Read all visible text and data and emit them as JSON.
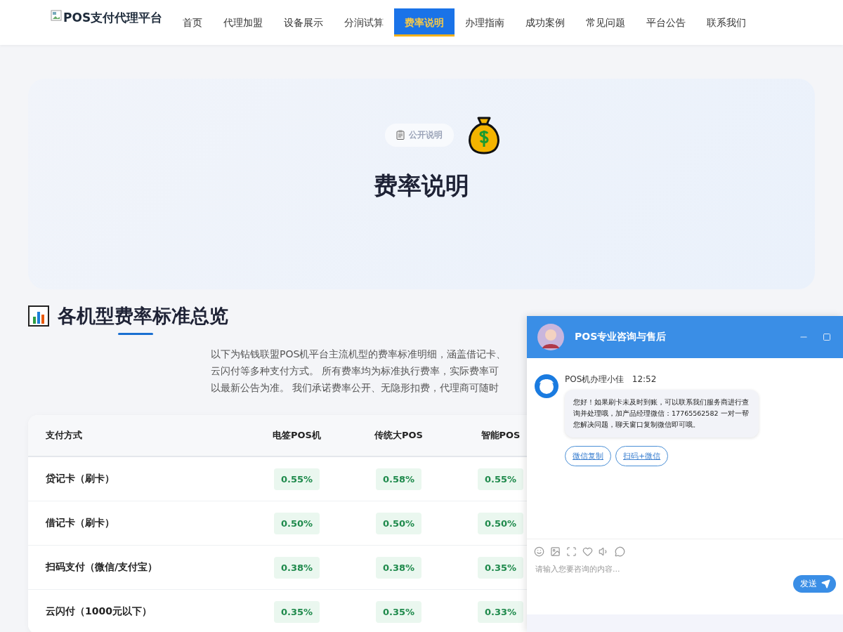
{
  "logo": {
    "alt_text": "POS支付代理平台"
  },
  "nav": [
    {
      "label": "首页",
      "selected": false
    },
    {
      "label": "代理加盟",
      "selected": false
    },
    {
      "label": "设备展示",
      "selected": false
    },
    {
      "label": "分润试算",
      "selected": false
    },
    {
      "label": "费率说明",
      "selected": true
    },
    {
      "label": "办理指南",
      "selected": false
    },
    {
      "label": "成功案例",
      "selected": false
    },
    {
      "label": "常见问题",
      "selected": false
    },
    {
      "label": "平台公告",
      "selected": false
    },
    {
      "label": "联系我们",
      "selected": false
    }
  ],
  "hero": {
    "badge": "公开说明",
    "title": "费率说明"
  },
  "section": {
    "title": "各机型费率标准总览",
    "intro_lines": [
      "以下为钻钱联盟POS机平台主流机型的费率标准明细，涵盖借记卡、",
      "云闪付等多种支付方式。 所有费率均为标准执行费率，实际费率可",
      "以最新公告为准。 我们承诺费率公开、无隐形扣费，代理商可随时"
    ]
  },
  "table": {
    "columns": [
      "支付方式",
      "电签POS机",
      "传统大POS",
      "智能POS"
    ],
    "rows": [
      {
        "method": "贷记卡（刷卡）",
        "rates": [
          "0.55%",
          "0.58%",
          "0.55%"
        ]
      },
      {
        "method": "借记卡（刷卡）",
        "rates": [
          "0.50%",
          "0.50%",
          "0.50%"
        ]
      },
      {
        "method": "扫码支付（微信/支付宝）",
        "rates": [
          "0.38%",
          "0.38%",
          "0.35%"
        ]
      },
      {
        "method": "云闪付（1000元以下）",
        "rates": [
          "0.35%",
          "0.35%",
          "0.33%"
        ]
      }
    ]
  },
  "chat": {
    "title": "POS专业咨询与售后",
    "agent": "POS机办理小佳",
    "time": "12:52",
    "message": "您好！如果刷卡未及时到账，可以联系我们服务商进行查询并处理哦，加产品经理微信：17765562582 一对一帮您解决问题，聊天窗口复制微信即可哦。",
    "quick_replies": [
      "微信复制",
      "扫码+微信"
    ],
    "input_placeholder": "请输入您要咨询的内容...",
    "send": "发送"
  }
}
